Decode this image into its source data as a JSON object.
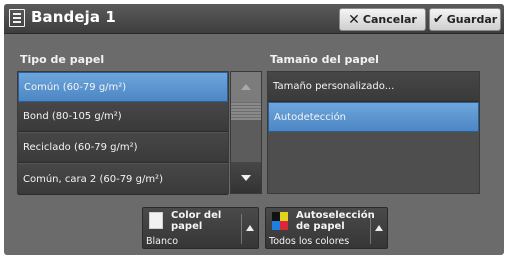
{
  "header": {
    "title": "Bandeja 1",
    "cancel_label": "Cancelar",
    "save_label": "Guardar"
  },
  "paper_type": {
    "heading": "Tipo de papel",
    "items": [
      {
        "label": "Común (60-79 g/m²)",
        "selected": true
      },
      {
        "label": "Bond (80-105 g/m²)",
        "selected": false
      },
      {
        "label": "Reciclado (60-79 g/m²)",
        "selected": false
      },
      {
        "label": "Común, cara 2 (60-79 g/m²)",
        "selected": false
      }
    ]
  },
  "paper_size": {
    "heading": "Tamaño del papel",
    "items": [
      {
        "label": "Tamaño personalizado...",
        "selected": false
      },
      {
        "label": "Autodetección",
        "selected": true
      }
    ]
  },
  "color_button": {
    "label": "Color del papel",
    "value": "Blanco"
  },
  "auto_button": {
    "label": "Autoselección de papel",
    "value": "Todos los colores"
  },
  "colors": {
    "selected": "#5a93d0",
    "panel": "#6b6b6b",
    "item": "#404040"
  },
  "icons": {
    "menu": "menu-icon",
    "cancel": "close-icon",
    "save": "checkmark-icon",
    "scroll_up": "arrow-up-icon",
    "scroll_down": "arrow-down-icon"
  }
}
